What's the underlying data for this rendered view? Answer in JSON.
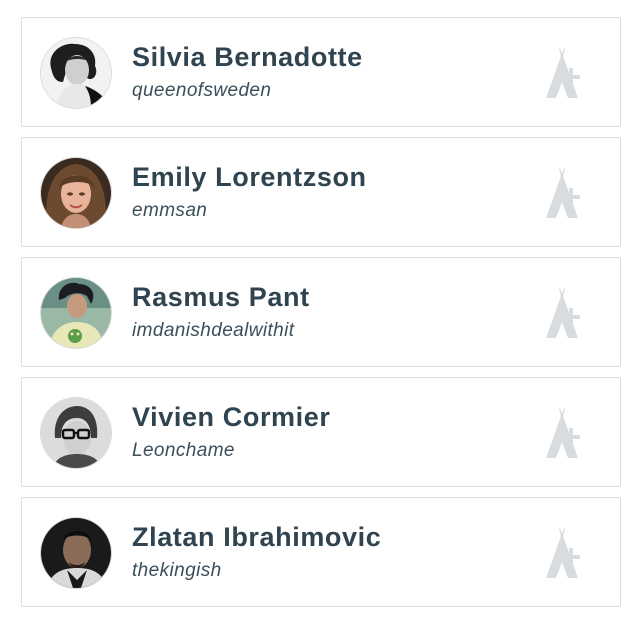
{
  "users": [
    {
      "name": "Silvia Bernadotte",
      "handle": "queenofsweden",
      "avatar_icon": "person-bw-portrait-icon"
    },
    {
      "name": "Emily Lorentzson",
      "handle": "emmsan",
      "avatar_icon": "person-portrait-icon"
    },
    {
      "name": "Rasmus Pant",
      "handle": "imdanishdealwithit",
      "avatar_icon": "person-portrait-icon"
    },
    {
      "name": "Vivien Cormier",
      "handle": "Leonchame",
      "avatar_icon": "person-glasses-portrait-icon"
    },
    {
      "name": "Zlatan Ibrahimovic",
      "handle": "thekingish",
      "avatar_icon": "person-dark-portrait-icon"
    }
  ],
  "follow_icon": "tent-plus-icon",
  "colors": {
    "name_text": "#2f4450",
    "handle_text": "#3b4f5a",
    "card_border": "#dcdfe1",
    "follow_icon": "#d8dcde"
  }
}
